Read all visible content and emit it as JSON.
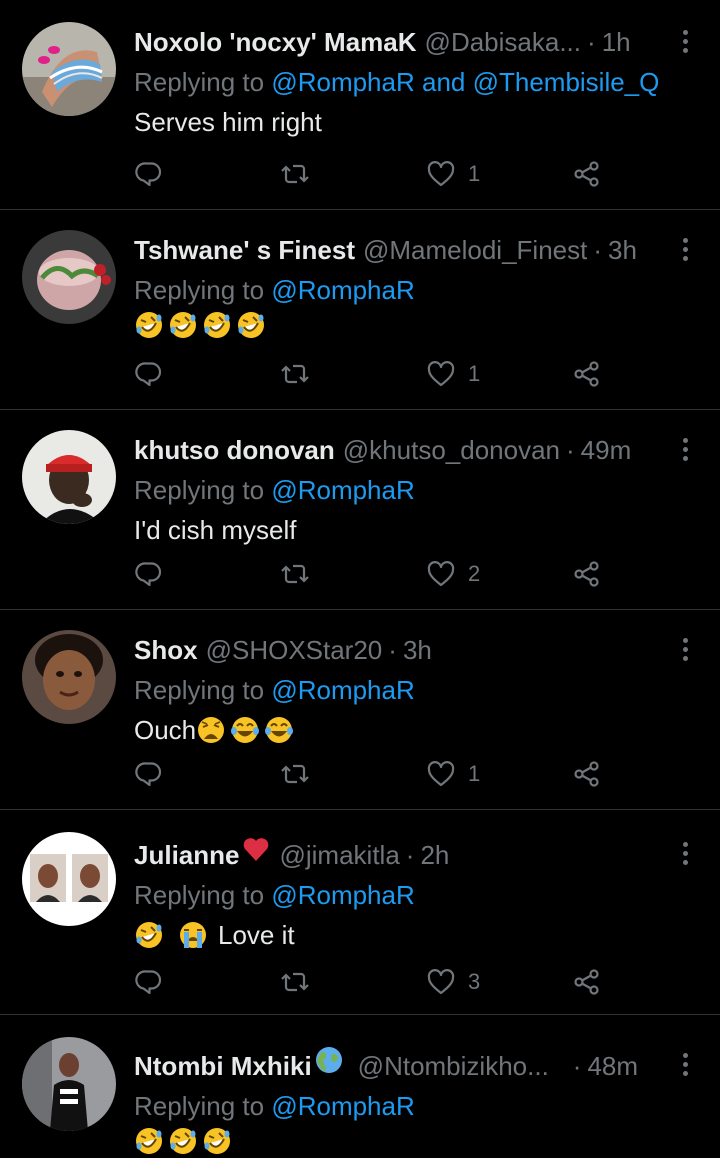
{
  "colors": {
    "background": "#000000",
    "text": "#e7e9ea",
    "muted": "#71767b",
    "link": "#1d9bf0",
    "divider": "#2f3336"
  },
  "replying_prefix": "Replying to",
  "tweets": [
    {
      "name": "Noxolo 'nocxy' MamaK",
      "handle": "@Dabisaka...",
      "time": "1h",
      "mentions": "@RomphaR and @Thembisile_Q",
      "text": "Serves him right",
      "emojis": [],
      "likes": "1",
      "avatar": "painted-nails-avatar"
    },
    {
      "name": "Tshwane' s Finest",
      "handle": "@Mamelodi_Finest",
      "time": "3h",
      "mentions": "@RomphaR",
      "text": "",
      "emojis": [
        "rofl-emoji",
        "rofl-emoji",
        "rofl-emoji",
        "rofl-emoji"
      ],
      "likes": "1",
      "avatar": "drink-glass-avatar"
    },
    {
      "name": "khutso donovan",
      "handle": "@khutso_donovan",
      "time": "49m",
      "mentions": "@RomphaR",
      "text": "I'd cish myself",
      "emojis": [],
      "likes": "2",
      "avatar": "red-beanie-avatar"
    },
    {
      "name": "Shox",
      "handle": "@SHOXStar20",
      "time": "3h",
      "mentions": "@RomphaR",
      "text": "Ouch",
      "emojis": [
        "weary-emoji",
        "joy-emoji",
        "joy-emoji"
      ],
      "likes": "1",
      "avatar": "selfie-avatar"
    },
    {
      "name": "Julianne",
      "name_emoji": "red-heart-emoji",
      "handle": "@jimakitla",
      "time": "2h",
      "mentions": "@RomphaR",
      "text": "Love it",
      "emojis_before": [
        "rofl-emoji",
        "loudly-crying-emoji"
      ],
      "likes": "3",
      "avatar": "two-photos-avatar"
    },
    {
      "name": "Ntombi Mxhiki",
      "name_emoji": "globe-emoji",
      "handle": "@Ntombizikho...",
      "time": "48m",
      "mentions": "@RomphaR",
      "text": "",
      "emojis": [
        "rofl-emoji",
        "rofl-emoji",
        "rofl-emoji"
      ],
      "likes": "",
      "avatar": "standing-person-avatar"
    }
  ]
}
